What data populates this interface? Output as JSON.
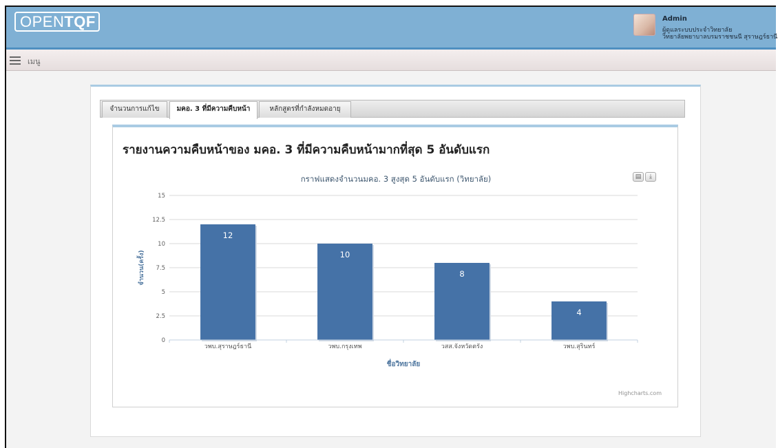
{
  "header": {
    "logo_light": "OPEN",
    "logo_bold": "TQF",
    "user_name": "Admin",
    "user_role": "ผู้ดูแลระบบประจำวิทยาลัย",
    "user_org": "วิทยาลัยพยาบาลบรมราชชนนี สุราษฎร์ธานี"
  },
  "menu": {
    "label": "เมนู",
    "icon": "hamburger-icon"
  },
  "tabs": [
    {
      "label": "จำนวนการแก้ไข",
      "active": false
    },
    {
      "label": "มคอ. 3 ที่มีความคืบหน้า",
      "active": true
    },
    {
      "label": "หลักสูตรที่กำลังหมดอายุ",
      "active": false
    }
  ],
  "report": {
    "title": "รายงานความคืบหน้าของ มคอ. 3 ที่มีความคืบหน้ามากที่สุด 5 อันดับแรก"
  },
  "chart_buttons": {
    "print_icon": "print-icon",
    "download_icon": "download-icon"
  },
  "colors": {
    "header": "#7fb0d4",
    "bar": "#4572a7",
    "accent": "#a9cbe3"
  },
  "chart_data": {
    "type": "bar",
    "title": "กราฟแสดงจำนวนมคอ. 3 สูงสุด 5 อันดับแรก (วิทยาลัย)",
    "xlabel": "ชื่อวิทยาลัย",
    "ylabel": "จำนวน(ครั้ง)",
    "categories": [
      "วพบ.สุราษฎร์ธานี",
      "วพบ.กรุงเทพ",
      "วสส.จังหวัดตรัง",
      "วพบ.สุรินทร์"
    ],
    "values": [
      12,
      10,
      8,
      4
    ],
    "yticks": [
      "0",
      "2.5",
      "5",
      "7.5",
      "10",
      "12.5",
      "15"
    ],
    "ylim": [
      0,
      15
    ],
    "grid": true,
    "data_labels": true,
    "credit": "Highcharts.com"
  }
}
